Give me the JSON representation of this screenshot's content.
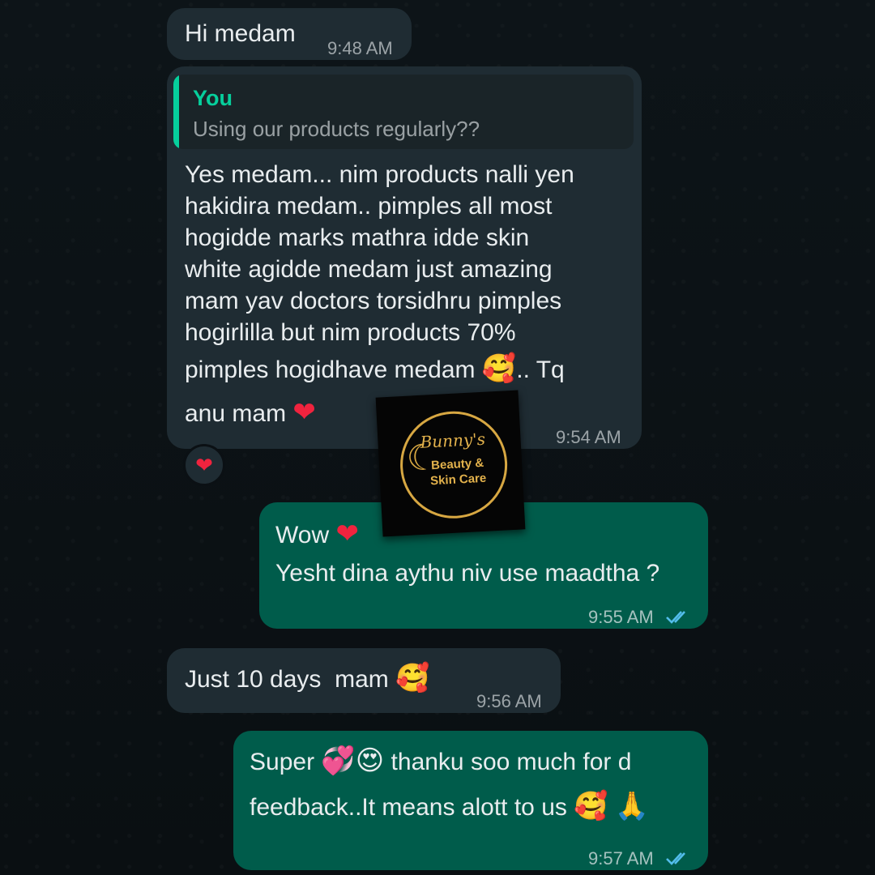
{
  "messages": [
    {
      "text": "Hi medam",
      "time": "9:48 AM",
      "direction": "incoming"
    },
    {
      "reply_to": {
        "author": "You",
        "text": "Using our products regularly??"
      },
      "lines": [
        "Yes medam... nim products nalli yen",
        "hakidira medam.. pimples all most",
        "hogidde marks mathra idde skin",
        "white agidde medam just amazing",
        "mam yav doctors torsidhru pimples",
        "hogirlilla but nim products 70%",
        "pimples hogidhave medam",
        ".. Tq",
        "anu mam"
      ],
      "time": "9:54 AM",
      "reaction": "❤",
      "direction": "incoming"
    },
    {
      "lines": [
        "Wow",
        "Yesht dina aythu niv use maadtha ?"
      ],
      "time": "9:55 AM",
      "direction": "outgoing",
      "status": "read"
    },
    {
      "text": "Just 10 days  mam",
      "time": "9:56 AM",
      "direction": "incoming"
    },
    {
      "lines": [
        "Super",
        "thanku soo much for d",
        "feedback..It means alott to us"
      ],
      "time": "9:57 AM",
      "direction": "outgoing",
      "status": "read"
    }
  ],
  "emojis": {
    "smiling_hearts": "🥰",
    "red_heart": "❤",
    "revolving_hearts": "💞",
    "heart_eyes": "😍",
    "folded_hands": "🙏"
  },
  "overlay_logo": {
    "name": "Bunny's",
    "subtitle_1": "Beauty &",
    "subtitle_2": "Skin Care"
  },
  "colors": {
    "incoming_bubble": "#1f2c33",
    "outgoing_bubble": "#005c4b",
    "read_ticks": "#53bdeb",
    "quote_accent": "#06cf9c",
    "logo_gold": "#d7a742"
  }
}
